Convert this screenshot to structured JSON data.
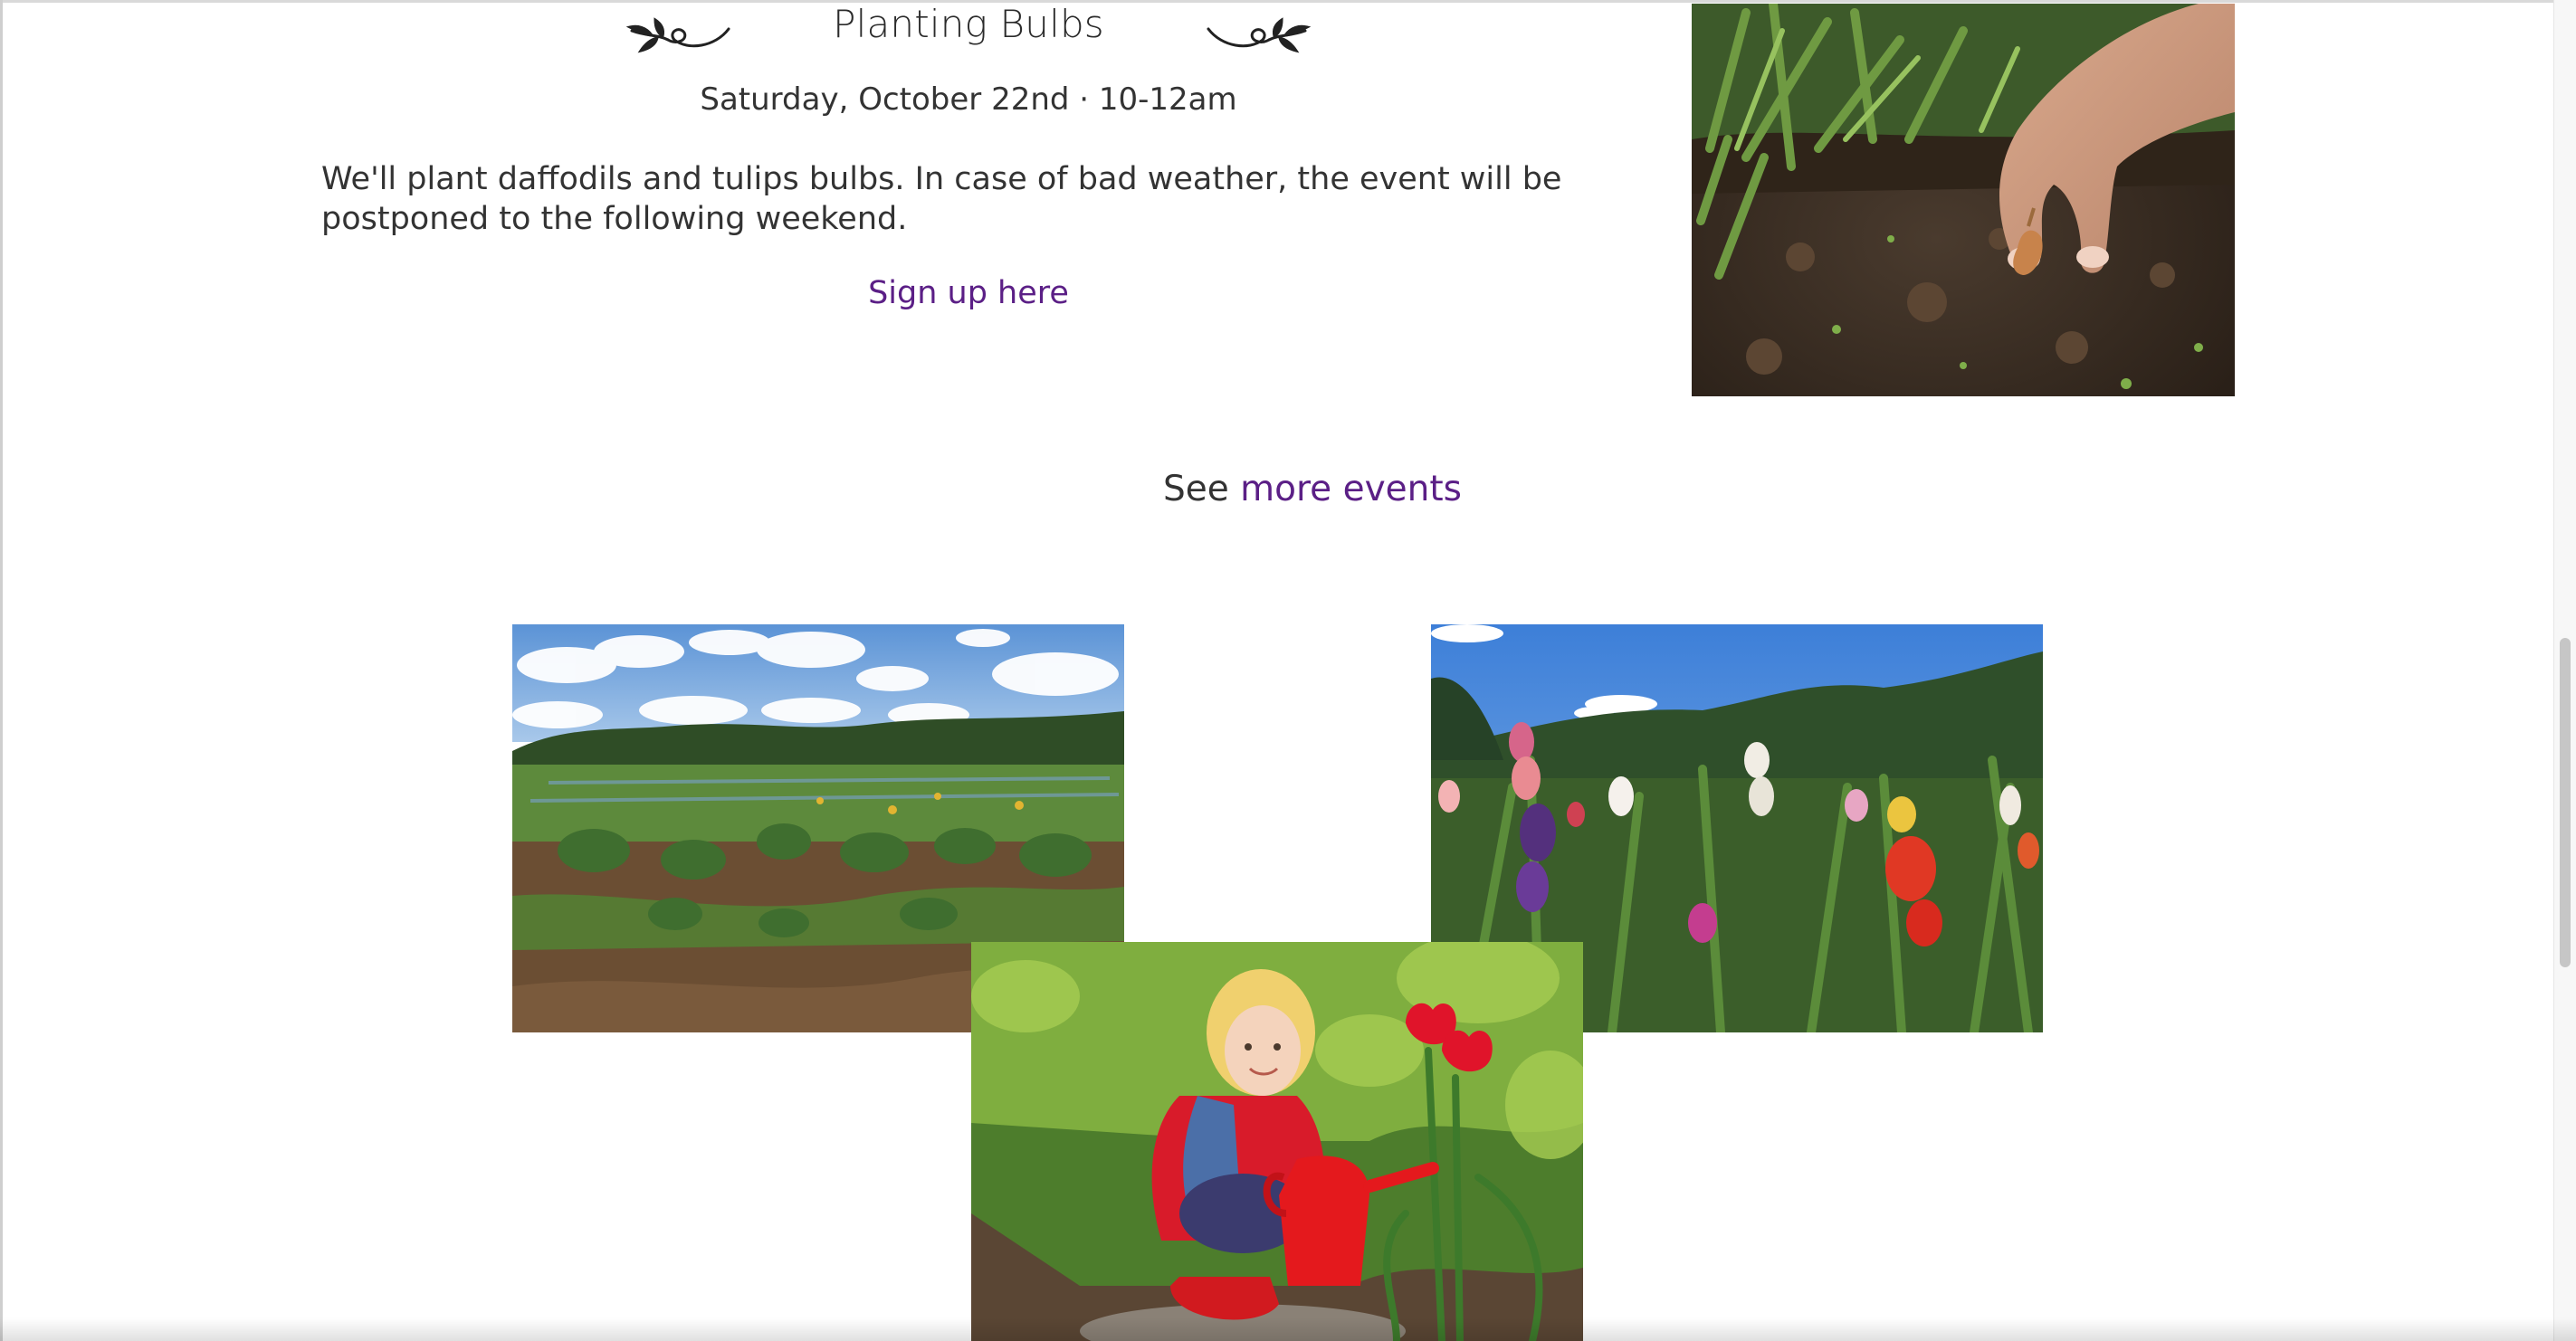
{
  "event": {
    "title": "Planting Bulbs",
    "date": "Saturday, October 22nd · 10-12am",
    "description": "We'll plant daffodils and tulips bulbs. In case of bad weather, the event will be postponed to the following weekend.",
    "signup_label": "Sign up here"
  },
  "more_events": {
    "prefix": "See ",
    "link_label": "more events"
  },
  "colors": {
    "link": "#5b1f86",
    "text": "#333333"
  },
  "icons": {
    "title_flourish_left": "leaf-flourish-icon",
    "title_flourish_right": "leaf-flourish-icon"
  },
  "images": {
    "event_photo": "hand-planting-bulb-photo",
    "gallery": [
      "vegetable-garden-photo",
      "gladiolus-flowers-photo",
      "child-watering-tulips-photo"
    ]
  }
}
